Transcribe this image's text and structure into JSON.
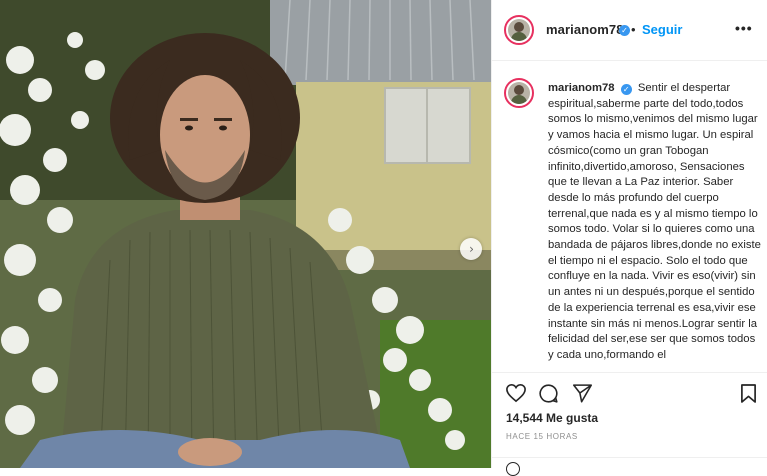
{
  "post": {
    "username": "marianom78",
    "verified_icon": "verified-badge-icon",
    "follow_label": "Seguir",
    "more_icon": "•••",
    "caption_user": "marianom78",
    "caption_text": "Sentir el despertar espiritual,saberme parte del todo,todos somos lo mismo,venimos del mismo lugar y vamos hacia el mismo lugar. Un espiral cósmico(como un gran Tobogan infinito,divertido,amoroso, Sensaciones que te llevan a La Paz interior. Saber desde lo más profundo del cuerpo terrenal,que nada es y al mismo tiempo lo somos todo. Volar si lo quieres como una bandada de pájaros libres,donde no existe el tiempo ni el espacio. Solo el todo que confluye en la nada. Vivir es eso(vivir) sin un antes ni un después,porque el sentido de la experiencia terrenal es esa,vivir ese instante sin más ni menos.Lograr sentir la felicidad del ser,ese ser que somos todos y cada uno,formando el",
    "likes": "14,544 Me gusta",
    "timestamp": "HACE 15 HORAS",
    "next_arrow": "›"
  },
  "colors": {
    "link_blue": "#0095f6",
    "verified_blue": "#3897f0",
    "story_ring": "#e7305f",
    "text": "#262626",
    "muted": "#8e8e8e"
  }
}
